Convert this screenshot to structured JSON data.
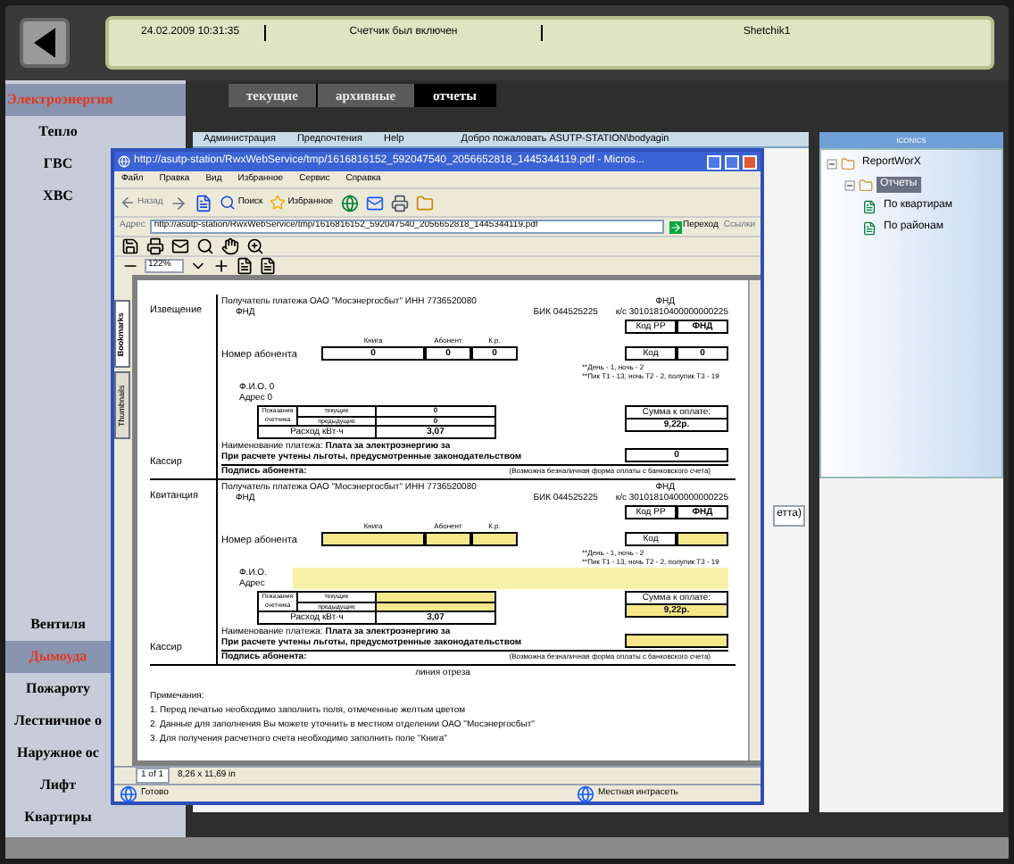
{
  "status_panel": {
    "timestamp": "24.02.2009 10:31:35",
    "message": "Счетчик был включен",
    "device": "Shetchik1"
  },
  "sidebar": {
    "items": [
      {
        "label": "Электроэнергия",
        "selected": true
      },
      {
        "label": "Тепло",
        "selected": false
      },
      {
        "label": "ГВС",
        "selected": false
      },
      {
        "label": "ХВС",
        "selected": false
      },
      {
        "label": "Вентиля",
        "selected": false
      },
      {
        "label": "Дымоуда",
        "selected": true
      },
      {
        "label": "Пожароту",
        "selected": false
      },
      {
        "label": "Лестничное о",
        "selected": false
      },
      {
        "label": "Наружное ос",
        "selected": false
      },
      {
        "label": "Лифт",
        "selected": false
      },
      {
        "label": "Квартиры",
        "selected": false
      }
    ]
  },
  "tabs": [
    {
      "label": "текущие",
      "selected": false
    },
    {
      "label": "архивные",
      "selected": false
    },
    {
      "label": "отчеты",
      "selected": true
    }
  ],
  "app_menu": {
    "items": [
      "Администрация",
      "Предпочтения",
      "Help"
    ],
    "welcome": "Добро пожаловать ASUTP-STATION\\bodyagin"
  },
  "tree_panel": {
    "title": "ICONICS",
    "items": [
      {
        "label": "ReportWorX",
        "expanded": true,
        "selected": false,
        "children": [
          {
            "label": "Отчеты",
            "expanded": true,
            "selected": true,
            "children": [
              {
                "label": "По квартирам",
                "selected": false
              },
              {
                "label": "По районам",
                "selected": false
              }
            ]
          }
        ]
      }
    ]
  },
  "background_list": {
    "text": "етта)"
  },
  "browser": {
    "title": "http://asutp-station/RwxWebService/tmp/1616816152_592047540_2056652818_1445344119.pdf - Micros...",
    "menu": [
      "Файл",
      "Правка",
      "Вид",
      "Избранное",
      "Сервис",
      "Справка"
    ],
    "toolbar": {
      "back": "Назад",
      "search": "Поиск",
      "favorites": "Избранное"
    },
    "address": {
      "label": "Адрес",
      "value": "http://asutp-station/RwxWebService/tmp/1616816152_592047540_2056652818_1445344119.pdf",
      "go": "Переход",
      "links": "Ссылки"
    },
    "zoom": "122%",
    "side_tabs": [
      {
        "label": "Bookmarks",
        "selected": true
      },
      {
        "label": "Thumbnails",
        "selected": false
      }
    ],
    "page_nav": {
      "page": "1 of 1",
      "size": "8,26 x 11,69 in"
    },
    "status": {
      "text": "Готово",
      "zone": "Местная интрасеть"
    }
  },
  "document": {
    "sections": [
      {
        "label": "Извещение",
        "highlighted": false,
        "recipient": "Получатель платежа ОАО \"Мосэнергосбыт\"  ИНН 7736520080",
        "fnd_left": "ФНД",
        "fnd_right": "ФНД",
        "bik": "БИК 044525225",
        "ks": "к/с 30101810400000000225",
        "code_rr_label": "Код РР",
        "code_rr_value": "ФНД",
        "account_label": "Номер абонента",
        "account_headers": [
          "Книга",
          "Абонент",
          "К.р."
        ],
        "account_values": [
          "0",
          "0",
          "0"
        ],
        "code_label": "Код",
        "code_value": "0",
        "hints": [
          "**День - 1, ночь - 2",
          "**Пик Т1 - 13, ночь Т2 - 2, полупик Т3 - 19"
        ],
        "fio_label": "Ф.И.О.",
        "fio_value": "0",
        "address_label": "Адрес",
        "address_value": "0",
        "readings_label": [
          "Показания",
          "счетчика"
        ],
        "current_label": "текущие",
        "current_value": "0",
        "previous_label": "предыдущие",
        "previous_value": "0",
        "usage_label": "Расход кВт·ч",
        "usage_value": "3,07",
        "sum_label": "Сумма к оплате:",
        "sum_value": "9,22р.",
        "payment_name": "Наименование платежа: **Плата за электроэнергию за**",
        "privileges": "При расчете учтены льготы, предусмотренные законодательством",
        "signature": "Подпись абонента:",
        "cashless": "(Возможна безналичная форма оплаты с банковского счета)",
        "cashier": "Кассир",
        "extra_value": "0"
      },
      {
        "label": "Квитанция",
        "highlighted": true,
        "recipient": "Получатель платежа ОАО \"Мосэнергосбыт\"  ИНН 7736520080",
        "fnd_left": "ФНД",
        "fnd_right": "ФНД",
        "bik": "БИК 044525225",
        "ks": "к/с 30101810400000000225",
        "code_rr_label": "Код РР",
        "code_rr_value": "ФНД",
        "account_label": "Номер абонента",
        "account_headers": [
          "Книга",
          "Абонент",
          "К.р."
        ],
        "code_label": "Код",
        "hints": [
          "**День - 1, ночь - 2",
          "**Пик Т1 - 13, ночь Т2 - 2, полупик Т3 - 19"
        ],
        "fio_label": "Ф.И.О.",
        "address_label": "Адрес",
        "readings_label": [
          "Показания",
          "счетчика"
        ],
        "current_label": "текущие",
        "previous_label": "предыдущие",
        "usage_label": "Расход кВт·ч",
        "usage_value": "3,07",
        "sum_label": "Сумма к оплате:",
        "sum_value": "9,22р.",
        "payment_name": "Наименование платежа: **Плата за электроэнергию за**",
        "privileges": "При расчете учтены льготы, предусмотренные законодательством",
        "signature": "Подпись абонента:",
        "cashless": "(Возможна безналичная форма оплаты с банковского счета)",
        "cashier": "Кассир"
      }
    ],
    "cut_line": "линия отреза",
    "notes_title": "Примечания:",
    "notes": [
      "1. Перед печатью необходимо заполнить поля, отмеченные желтым цветом",
      "2. Данные для заполнения Вы можете уточнить в местном отделении ОАО \"Мосэнергосбыт\"",
      "3. Для получения расчетного счета необходимо заполнить поле \"Книга\""
    ]
  }
}
